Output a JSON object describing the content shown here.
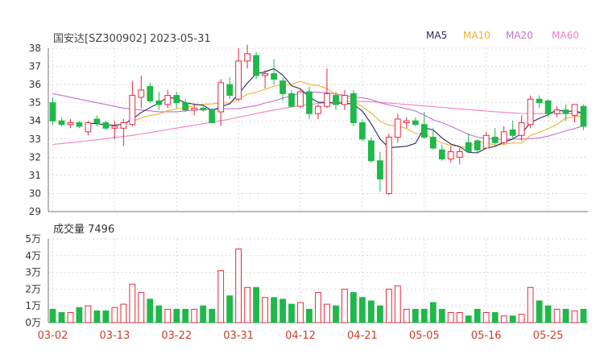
{
  "header": {
    "title": "国安达[SZ300902] 2023-05-31",
    "volume_label": "成交量 7496"
  },
  "legend": [
    {
      "label": "MA5",
      "color": "#2a2a5a"
    },
    {
      "label": "MA10",
      "color": "#f0b030"
    },
    {
      "label": "MA20",
      "color": "#c070d0"
    },
    {
      "label": "MA60",
      "color": "#f080c0"
    }
  ],
  "colors": {
    "up": "#e8283c",
    "down": "#1fb84a",
    "axis": "#777777",
    "grid": "#d9d9d9",
    "date_label": "#c8402f"
  },
  "chart_data": [
    {
      "type": "candlestick",
      "y_ticks": [
        38,
        37,
        36,
        35,
        34,
        33,
        32,
        31,
        30,
        29
      ],
      "ylim": [
        29,
        38
      ],
      "x_tick_labels": [
        {
          "label": "03-02",
          "index": 0
        },
        {
          "label": "03-13",
          "index": 7
        },
        {
          "label": "03-22",
          "index": 14
        },
        {
          "label": "03-31",
          "index": 21
        },
        {
          "label": "04-12",
          "index": 28
        },
        {
          "label": "04-21",
          "index": 35
        },
        {
          "label": "05-05",
          "index": 42
        },
        {
          "label": "05-16",
          "index": 49
        },
        {
          "label": "05-25",
          "index": 56
        }
      ],
      "ohlc": [
        [
          35.0,
          35.3,
          33.8,
          34.0
        ],
        [
          34.0,
          34.2,
          33.7,
          33.8
        ],
        [
          33.8,
          34.1,
          33.6,
          33.9
        ],
        [
          33.9,
          34.0,
          33.6,
          33.7
        ],
        [
          33.4,
          34.0,
          33.2,
          33.9
        ],
        [
          34.1,
          34.3,
          33.7,
          33.9
        ],
        [
          33.9,
          34.0,
          33.5,
          33.6
        ],
        [
          33.6,
          34.0,
          33.0,
          33.7
        ],
        [
          33.6,
          34.1,
          32.6,
          33.9
        ],
        [
          33.8,
          36.2,
          33.7,
          35.4
        ],
        [
          35.3,
          36.5,
          34.7,
          35.7
        ],
        [
          35.9,
          36.1,
          35.0,
          35.1
        ],
        [
          35.1,
          35.6,
          34.6,
          34.9
        ],
        [
          34.9,
          35.7,
          34.7,
          35.4
        ],
        [
          35.4,
          35.6,
          34.7,
          35.0
        ],
        [
          35.0,
          35.2,
          34.5,
          34.6
        ],
        [
          34.6,
          34.9,
          34.3,
          34.7
        ],
        [
          34.7,
          34.8,
          34.5,
          34.6
        ],
        [
          34.6,
          34.7,
          33.9,
          33.9
        ],
        [
          34.5,
          36.3,
          33.7,
          36.1
        ],
        [
          36.0,
          36.4,
          35.2,
          35.4
        ],
        [
          35.2,
          38.0,
          35.1,
          37.3
        ],
        [
          37.3,
          38.2,
          36.9,
          37.7
        ],
        [
          37.6,
          37.8,
          36.3,
          36.5
        ],
        [
          36.5,
          36.8,
          35.8,
          36.6
        ],
        [
          36.6,
          37.4,
          36.0,
          36.3
        ],
        [
          36.2,
          36.4,
          35.1,
          35.5
        ],
        [
          35.5,
          35.7,
          34.8,
          34.8
        ],
        [
          34.8,
          35.8,
          34.7,
          35.6
        ],
        [
          35.6,
          35.9,
          34.1,
          34.4
        ],
        [
          34.4,
          34.9,
          34.1,
          34.8
        ],
        [
          34.8,
          36.9,
          34.7,
          35.5
        ],
        [
          35.4,
          35.6,
          34.6,
          34.9
        ],
        [
          34.9,
          35.7,
          34.6,
          35.4
        ],
        [
          35.5,
          35.7,
          33.7,
          33.9
        ],
        [
          33.9,
          34.1,
          32.9,
          33.0
        ],
        [
          32.9,
          33.1,
          31.7,
          31.8
        ],
        [
          31.8,
          32.3,
          30.1,
          30.8
        ],
        [
          30.0,
          33.3,
          29.9,
          33.1
        ],
        [
          33.1,
          34.4,
          32.8,
          34.1
        ],
        [
          33.9,
          34.2,
          33.6,
          34.0
        ],
        [
          34.0,
          34.2,
          33.7,
          33.8
        ],
        [
          33.8,
          34.5,
          33.0,
          33.1
        ],
        [
          33.1,
          33.6,
          32.4,
          32.5
        ],
        [
          32.4,
          32.7,
          31.8,
          31.9
        ],
        [
          31.9,
          32.6,
          31.7,
          32.3
        ],
        [
          32.0,
          32.5,
          31.6,
          32.3
        ],
        [
          32.8,
          33.3,
          32.5,
          32.3
        ],
        [
          32.9,
          33.0,
          32.2,
          32.4
        ],
        [
          32.5,
          33.4,
          32.5,
          33.2
        ],
        [
          33.1,
          33.6,
          32.7,
          32.8
        ],
        [
          32.8,
          33.7,
          32.7,
          33.4
        ],
        [
          33.5,
          34.0,
          33.0,
          33.2
        ],
        [
          33.2,
          34.3,
          32.9,
          33.9
        ],
        [
          33.8,
          35.4,
          33.6,
          35.2
        ],
        [
          35.2,
          35.4,
          34.7,
          35.0
        ],
        [
          35.1,
          35.2,
          34.2,
          34.4
        ],
        [
          34.4,
          34.8,
          34.2,
          34.6
        ],
        [
          34.6,
          34.9,
          34.0,
          34.4
        ],
        [
          34.3,
          34.9,
          33.9,
          34.9
        ],
        [
          34.8,
          34.9,
          33.5,
          33.7
        ]
      ],
      "ma5": [
        null,
        null,
        null,
        null,
        33.86,
        33.85,
        33.77,
        33.76,
        33.81,
        34.1,
        34.46,
        34.73,
        34.99,
        35.3,
        35.22,
        35.0,
        34.92,
        34.86,
        34.56,
        34.78,
        34.94,
        35.48,
        36.08,
        36.6,
        36.7,
        36.88,
        36.52,
        35.94,
        35.76,
        35.32,
        35.02,
        35.02,
        34.96,
        35.0,
        34.9,
        34.54,
        33.84,
        33.0,
        32.52,
        32.56,
        32.6,
        32.76,
        33.62,
        33.5,
        33.06,
        32.72,
        32.58,
        32.26,
        32.24,
        32.5,
        32.6,
        32.82,
        33.0,
        33.3,
        33.9,
        34.14,
        34.34,
        34.62,
        34.5,
        34.56,
        34.4
      ],
      "ma10": [
        null,
        null,
        null,
        null,
        null,
        null,
        null,
        null,
        null,
        33.98,
        34.16,
        34.29,
        34.38,
        34.56,
        34.66,
        34.73,
        34.83,
        34.92,
        34.93,
        35.0,
        34.97,
        35.2,
        35.47,
        35.58,
        35.74,
        35.91,
        36.0,
        36.01,
        36.18,
        36.01,
        35.95,
        35.77,
        35.45,
        35.38,
        35.11,
        34.78,
        34.43,
        33.98,
        33.76,
        33.73,
        33.57,
        33.3,
        33.31,
        33.01,
        32.79,
        32.64,
        32.59,
        32.51,
        32.87,
        32.78,
        32.66,
        32.7,
        32.79,
        32.77,
        33.2,
        33.37,
        33.58,
        33.81,
        34.15,
        34.23,
        34.27
      ],
      "ma20": [
        35.5,
        35.4,
        35.3,
        35.2,
        35.1,
        35.0,
        34.9,
        34.8,
        34.7,
        34.65,
        34.6,
        34.55,
        34.5,
        34.5,
        34.5,
        34.55,
        34.6,
        34.62,
        34.64,
        34.66,
        34.67,
        34.68,
        34.76,
        34.84,
        34.98,
        35.1,
        35.25,
        35.38,
        35.55,
        35.58,
        35.58,
        35.55,
        35.48,
        35.41,
        35.31,
        35.27,
        35.18,
        35.0,
        34.88,
        34.78,
        34.66,
        34.54,
        34.32,
        34.06,
        33.9,
        33.7,
        33.48,
        33.25,
        33.1,
        33.03,
        33.0,
        32.98,
        33.0,
        33.0,
        33.02,
        33.06,
        33.16,
        33.3,
        33.45,
        33.58,
        33.72
      ],
      "ma60": [
        32.7,
        32.75,
        32.8,
        32.85,
        32.9,
        32.96,
        33.02,
        33.08,
        33.14,
        33.2,
        33.28,
        33.36,
        33.44,
        33.52,
        33.6,
        33.68,
        33.76,
        33.84,
        33.92,
        34.0,
        34.1,
        34.2,
        34.3,
        34.4,
        34.5,
        34.6,
        34.68,
        34.76,
        34.84,
        34.9,
        34.96,
        35.0,
        35.04,
        35.06,
        35.08,
        35.08,
        35.06,
        35.02,
        34.98,
        34.94,
        34.9,
        34.86,
        34.82,
        34.78,
        34.74,
        34.7,
        34.66,
        34.62,
        34.58,
        34.54,
        34.5,
        34.47,
        34.44,
        34.41,
        34.4,
        34.4,
        34.4,
        34.4,
        34.4,
        34.42,
        34.44
      ]
    },
    {
      "type": "bar",
      "title": "成交量 7496",
      "y_ticks": [
        "5万",
        "4万",
        "3万",
        "2万",
        "1万",
        "0万"
      ],
      "y_tick_values": [
        5,
        4,
        3,
        2,
        1,
        0
      ],
      "ylim": [
        0,
        5
      ],
      "unit": "万",
      "values": [
        0.8,
        0.6,
        0.6,
        0.9,
        1.0,
        0.7,
        0.7,
        0.9,
        1.1,
        2.3,
        1.8,
        1.4,
        1.0,
        0.8,
        0.8,
        0.8,
        0.8,
        1.0,
        0.8,
        3.1,
        1.6,
        4.4,
        2.1,
        2.1,
        1.5,
        1.5,
        1.4,
        1.1,
        1.2,
        0.8,
        1.8,
        1.1,
        1.0,
        2.0,
        1.8,
        1.5,
        1.3,
        1.0,
        2.0,
        2.2,
        0.8,
        0.8,
        0.8,
        1.2,
        0.8,
        0.6,
        0.6,
        0.4,
        0.8,
        0.6,
        0.6,
        0.4,
        0.4,
        0.5,
        2.1,
        1.3,
        1.0,
        0.8,
        0.8,
        0.7,
        0.8
      ]
    }
  ]
}
